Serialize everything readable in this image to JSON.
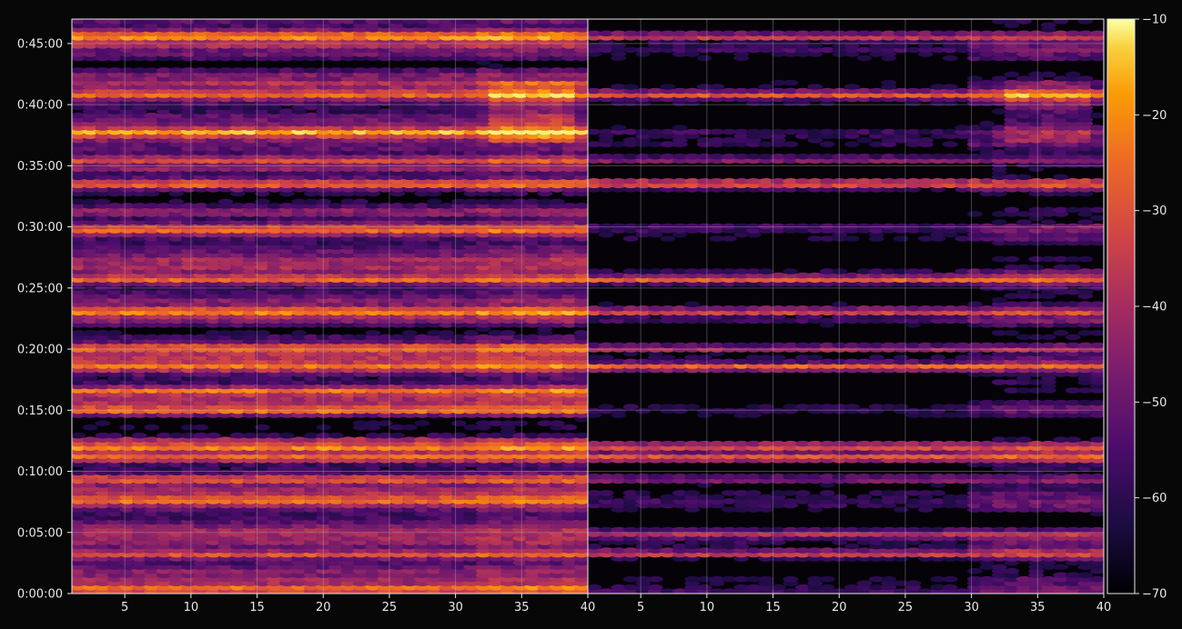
{
  "chart_data": {
    "type": "heatmap",
    "title": "",
    "xlabel": "",
    "ylabel": "",
    "grid": true,
    "colormap": "inferno",
    "background_color": "#070707",
    "panels": [
      {
        "name": "",
        "xlim": [
          1,
          40
        ],
        "xticks": [
          5,
          10,
          15,
          20,
          25,
          30,
          35,
          40
        ],
        "bright_rows_minutes": [
          0.4,
          3.2,
          7.6,
          9.4,
          11.2,
          12.0,
          15.0,
          16.6,
          18.6,
          20.1,
          23.1,
          25.7,
          29.8,
          33.5,
          35.5,
          37.7,
          40.8,
          45.6
        ],
        "quiet_rows_minutes": [
          13.2,
          14.2,
          21.6,
          30.6,
          32.3,
          34.3,
          43.3
        ],
        "hot_region": {
          "x": [
            33,
            39
          ],
          "minutes": [
            37,
            42
          ]
        }
      },
      {
        "name": "",
        "xlim": [
          1,
          40
        ],
        "xticks": [
          5,
          10,
          15,
          20,
          25,
          30,
          35,
          40
        ],
        "bright_rows_minutes": [
          3.2,
          4.9,
          9.4,
          11.2,
          12.0,
          18.6,
          20.1,
          23.1,
          25.7,
          33.5,
          35.5,
          40.8,
          45.6
        ],
        "quiet_rows_minutes": [
          6.0,
          13.2,
          14.2,
          16.0,
          21.6,
          26.8,
          28.0,
          30.6,
          32.3,
          34.3,
          43.3
        ],
        "hot_region": {
          "x": [
            33,
            39
          ],
          "minutes": [
            37,
            42
          ]
        }
      }
    ],
    "ylim_minutes": [
      0,
      47
    ],
    "yticks": [
      {
        "minutes": 0,
        "label": "0:00:00"
      },
      {
        "minutes": 5,
        "label": "0:05:00"
      },
      {
        "minutes": 10,
        "label": "0:10:00"
      },
      {
        "minutes": 15,
        "label": "0:15:00"
      },
      {
        "minutes": 20,
        "label": "0:20:00"
      },
      {
        "minutes": 25,
        "label": "0:25:00"
      },
      {
        "minutes": 30,
        "label": "0:30:00"
      },
      {
        "minutes": 35,
        "label": "0:35:00"
      },
      {
        "minutes": 40,
        "label": "0:40:00"
      },
      {
        "minutes": 45,
        "label": "0:45:00"
      }
    ],
    "colorbar": {
      "range": [
        -70,
        -10
      ],
      "ticks": [
        -70,
        -60,
        -50,
        -40,
        -30,
        -20,
        -10
      ],
      "tick_labels": [
        "−70",
        "−60",
        "−50",
        "−40",
        "−30",
        "−20",
        "−10"
      ]
    }
  }
}
